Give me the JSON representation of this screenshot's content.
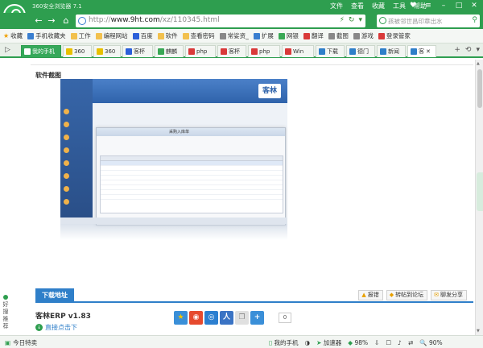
{
  "browser": {
    "app_title": "360安全浏览器 7.1",
    "menu": [
      "文件",
      "查看",
      "收藏",
      "工具",
      "帮助"
    ],
    "url_domain": "www.9ht.com",
    "url_path": "/xz/110345.html",
    "url_prefix": "http://",
    "search_placeholder": "孩被邻世昌印章出水"
  },
  "bookmarks": [
    {
      "label": "收藏",
      "icon": "star-icon"
    },
    {
      "label": "手机收藏夹",
      "icon": "folder-icon"
    },
    {
      "label": "工作",
      "icon": "folder-icon"
    },
    {
      "label": "编程网站",
      "icon": "folder-icon"
    },
    {
      "label": "百度",
      "icon": "baidu-icon"
    },
    {
      "label": "软件",
      "icon": "folder-icon"
    },
    {
      "label": "查看密码",
      "icon": "folder-icon"
    },
    {
      "label": "常娑资_",
      "icon": "chart-icon"
    },
    {
      "label": "扩展",
      "icon": "grid-icon"
    },
    {
      "label": "网银",
      "icon": "bank-icon"
    },
    {
      "label": "翻译",
      "icon": "translate-icon"
    },
    {
      "label": "截图",
      "icon": "scissors-icon"
    },
    {
      "label": "游戏",
      "icon": "gamepad-icon"
    },
    {
      "label": "登录管家",
      "icon": "login-icon"
    }
  ],
  "tabs": [
    {
      "label": "我的手机",
      "color": "#36a85a"
    },
    {
      "label": "360",
      "color": "#e8c000"
    },
    {
      "label": "360",
      "color": "#e8c000"
    },
    {
      "label": "客杯",
      "color": "#2b5fd9"
    },
    {
      "label": "麒麟",
      "color": "#3aa856"
    },
    {
      "label": "php",
      "color": "#d93a3a"
    },
    {
      "label": "客杯",
      "color": "#d93a3a"
    },
    {
      "label": "php",
      "color": "#d93a3a"
    },
    {
      "label": "Win",
      "color": "#d93a3a"
    },
    {
      "label": "下载",
      "color": "#2f7fc9"
    },
    {
      "label": "德门",
      "color": "#2f7fc9"
    },
    {
      "label": "新闻",
      "color": "#2f7fc9"
    },
    {
      "label": "客",
      "color": "#2f7fc9"
    }
  ],
  "page": {
    "section_title": "软件截图",
    "download_tab": "下载地址",
    "actions": [
      "报错",
      "转帖到论坛",
      "聊发分享"
    ],
    "app_name": "客林ERP v1.83",
    "direct_download": "直接点击下",
    "share_count": "0",
    "recommend": "好搜推荐"
  },
  "screenshot": {
    "dialog_title": "采购入库单",
    "logo": "客林"
  },
  "status": {
    "left": "今日特卖",
    "my_phone": "我的手机",
    "accelerator": "加速器",
    "speed": "98%",
    "zoom": "90%"
  }
}
